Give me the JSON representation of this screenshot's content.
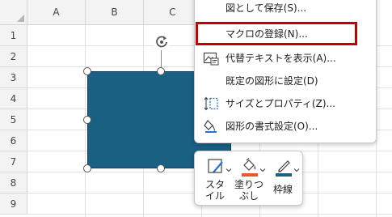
{
  "spreadsheet": {
    "columns": [
      "A",
      "B",
      "C"
    ],
    "rows": [
      "1",
      "2",
      "3",
      "4",
      "5",
      "6",
      "7",
      "8",
      "9",
      "10"
    ]
  },
  "shape": {
    "fill": "#1a6083"
  },
  "context_menu": {
    "highlight_color": "#c00000",
    "items": [
      {
        "label": "図として保存(S)...",
        "icon": "save-as-picture-icon"
      },
      {
        "label": "マクロの登録(N)...",
        "icon": "",
        "highlighted": true
      },
      {
        "label": "代替テキストを表示(A)...",
        "icon": "alt-text-icon"
      },
      {
        "label": "既定の図形に設定(D)",
        "icon": ""
      },
      {
        "label": "サイズとプロパティ(Z)...",
        "icon": "size-properties-icon"
      },
      {
        "label": "図形の書式設定(O)...",
        "icon": "format-shape-icon"
      }
    ]
  },
  "mini_toolbar": {
    "items": [
      {
        "label": "スタ\nイル",
        "icon": "shape-styles-icon"
      },
      {
        "label": "塗りつ\nぶし",
        "icon": "shape-fill-icon",
        "accent": "#e8582a"
      },
      {
        "label": "枠線",
        "icon": "shape-outline-icon",
        "accent": "#1a6083"
      }
    ]
  }
}
